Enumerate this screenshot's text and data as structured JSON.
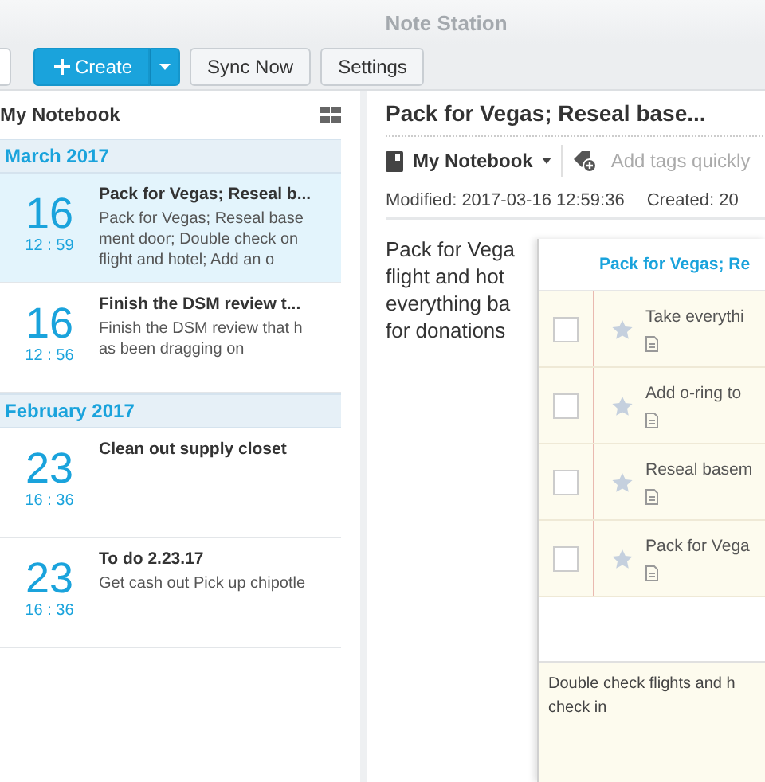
{
  "window": {
    "title": "Note Station"
  },
  "toolbar": {
    "buttons": [
      {
        "kind": "split",
        "label": "Create"
      },
      {
        "kind": "plain",
        "label": "Sync Now"
      },
      {
        "kind": "plain",
        "label": "Settings"
      }
    ]
  },
  "note_list": {
    "title": "My Notebook",
    "groups": [
      {
        "label": "March 2017",
        "notes": [
          {
            "day": "16",
            "time": "12 : 59",
            "title": "Pack for Vegas; Reseal b...",
            "snippet_lines": [
              "Pack for Vegas; Reseal base",
              "ment door; Double check on",
              "flight and hotel; Add an o"
            ],
            "selected": true
          },
          {
            "day": "16",
            "time": "12 : 56",
            "title": "Finish the DSM review t...",
            "snippet_lines": [
              "Finish the DSM review that h",
              "as been dragging on"
            ],
            "selected": false
          }
        ]
      },
      {
        "label": "February 2017",
        "notes": [
          {
            "day": "23",
            "time": "16 : 36",
            "title": "Clean out supply closet",
            "selected": false
          },
          {
            "day": "23",
            "time": "16 : 36",
            "title": "To do 2.23.17",
            "snippet_lines": [
              "Get cash out Pick up chipotle"
            ],
            "selected": false
          }
        ]
      }
    ]
  },
  "note": {
    "title": "Pack for Vegas; Reseal base...",
    "notebook": "My Notebook",
    "tags": {
      "placeholder": "Add tags quickly"
    },
    "modified": "Modified: 2017-03-16 12:59:36",
    "created": "Created: 20",
    "body_lines": [
      "Pack for Vega",
      "flight and hot",
      "everything ba",
      "for donations"
    ]
  },
  "todo_popup": {
    "title": "Pack for Vegas; Re",
    "tasks": [
      {
        "text": "Take everythi",
        "checked": false,
        "starred": false
      },
      {
        "text": "Add o-ring to",
        "checked": false,
        "starred": false
      },
      {
        "text": "Reseal basem",
        "checked": false,
        "starred": false
      },
      {
        "text": "Pack for Vega",
        "checked": false,
        "starred": false
      }
    ],
    "note_lines": [
      "Double check flights and h",
      "check in"
    ]
  }
}
